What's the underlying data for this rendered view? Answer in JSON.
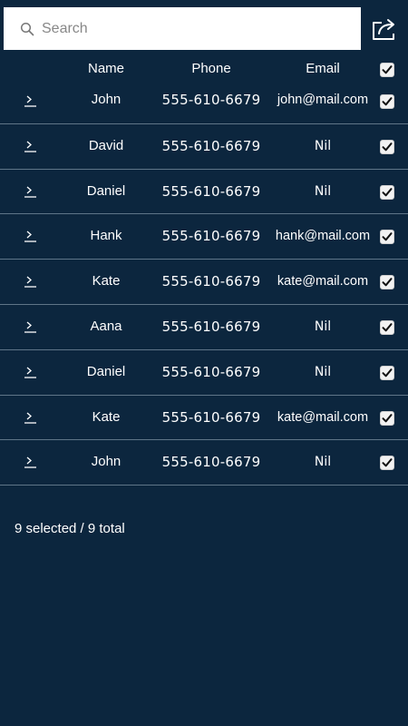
{
  "search": {
    "placeholder": "Search"
  },
  "toolbar": {
    "share_icon": "share-icon"
  },
  "table": {
    "headers": {
      "name": "Name",
      "phone": "Phone",
      "email": "Email"
    },
    "select_all_checked": true,
    "rows": [
      {
        "name": "John",
        "phone": "555-610-6679",
        "email": "john@mail.com",
        "checked": true
      },
      {
        "name": "David",
        "phone": "555-610-6679",
        "email": "Nil",
        "checked": true
      },
      {
        "name": "Daniel",
        "phone": "555-610-6679",
        "email": "Nil",
        "checked": true
      },
      {
        "name": "Hank",
        "phone": "555-610-6679",
        "email": "hank@mail.com",
        "checked": true
      },
      {
        "name": "Kate",
        "phone": "555-610-6679",
        "email": "kate@mail.com",
        "checked": true
      },
      {
        "name": "Aana",
        "phone": "555-610-6679",
        "email": "Nil",
        "checked": true
      },
      {
        "name": "Daniel",
        "phone": "555-610-6679",
        "email": "Nil",
        "checked": true
      },
      {
        "name": "Kate",
        "phone": "555-610-6679",
        "email": "kate@mail.com",
        "checked": true
      },
      {
        "name": "John",
        "phone": "555-610-6679",
        "email": "Nil",
        "checked": true
      }
    ]
  },
  "footer": {
    "status": "9 selected / 9 total"
  },
  "colors": {
    "background": "#0c263e",
    "divider": "#5f7588",
    "text": "#ffffff"
  }
}
